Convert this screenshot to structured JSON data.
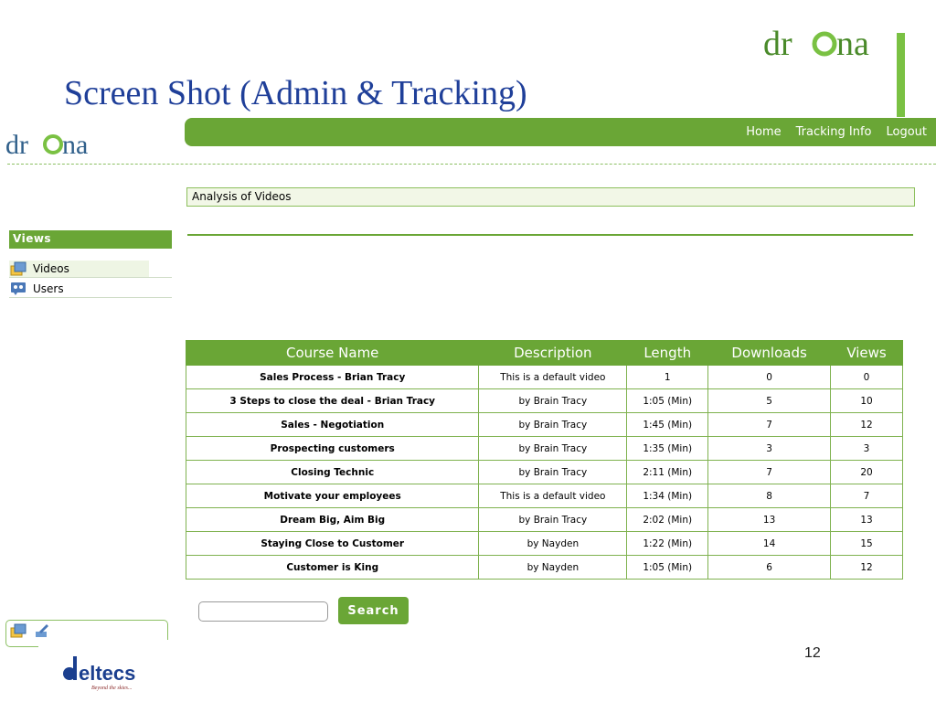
{
  "slide": {
    "title": "Screen Shot (Admin & Tracking)",
    "brand_logo_text": "drOna",
    "page_number": "12",
    "accent_color": "#7ac143"
  },
  "app": {
    "logo_text": "drOna",
    "nav": [
      "Home",
      "Tracking Info",
      "Logout"
    ],
    "section_title": "Analysis of Videos",
    "brand_color": "#6aa636"
  },
  "sidebar": {
    "header": "Views",
    "items": [
      {
        "label": "Videos",
        "icon": "videos-icon",
        "active": true
      },
      {
        "label": "Users",
        "icon": "users-icon",
        "active": false
      }
    ]
  },
  "table": {
    "columns": [
      "Course Name",
      "Description",
      "Length",
      "Downloads",
      "Views"
    ],
    "rows": [
      [
        "Sales Process - Brian Tracy",
        "This is a default video",
        "1",
        "0",
        "0"
      ],
      [
        "3 Steps to close the deal - Brian Tracy",
        "by Brain Tracy",
        "1:05 (Min)",
        "5",
        "10"
      ],
      [
        "Sales - Negotiation",
        "by Brain Tracy",
        "1:45 (Min)",
        "7",
        "12"
      ],
      [
        "Prospecting customers",
        "by Brain Tracy",
        "1:35 (Min)",
        "3",
        "3"
      ],
      [
        "Closing Technic",
        "by Brain Tracy",
        "2:11 (Min)",
        "7",
        "20"
      ],
      [
        "Motivate your employees",
        "This is a default video",
        "1:34 (Min)",
        "8",
        "7"
      ],
      [
        "Dream Big, Aim Big",
        "by Brain Tracy",
        "2:02 (Min)",
        "13",
        "13"
      ],
      [
        "Staying Close to Customer",
        "by Nayden",
        "1:22 (Min)",
        "14",
        "15"
      ],
      [
        "Customer is King",
        "by Nayden",
        "1:05 (Min)",
        "6",
        "12"
      ]
    ]
  },
  "search": {
    "value": "",
    "button_label": "Search"
  },
  "footer_logo": {
    "name": "deltecs",
    "tagline": "Beyond the skies..."
  }
}
